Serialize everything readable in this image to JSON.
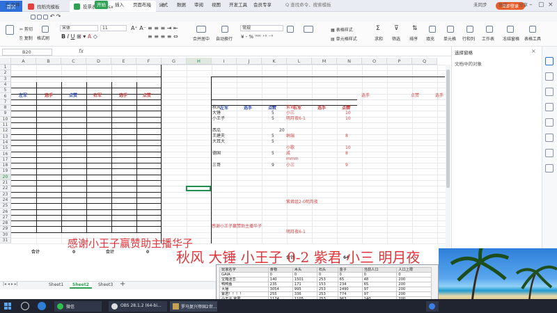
{
  "titlebar": {
    "tabs": [
      {
        "label": "首页",
        "icon": "home-icon"
      },
      {
        "label": "找稻壳模板",
        "icon": "docer-icon"
      },
      {
        "label": "投票表(1).xlsx",
        "icon": "sheet-icon"
      }
    ],
    "login_label": "立即登录"
  },
  "menu": {
    "file": "三 文件",
    "items": [
      "开始",
      "插入",
      "页面布局",
      "公式",
      "数据",
      "审阅",
      "视图",
      "开发工具",
      "会员专享"
    ],
    "search": "Q 查找命令、搜索模板",
    "sync": "未同步",
    "collab": "协作",
    "share": "分享"
  },
  "ribbon": {
    "cut": "剪切",
    "copy": "复制",
    "format_painter": "格式刷",
    "font": "宋体",
    "font_size": "11",
    "number_format": "常规",
    "merge": "合并居中",
    "wrap": "自动换行",
    "table_style": "表格样式",
    "cell_style": "单元格样式",
    "sum": "求和",
    "filter": "筛选",
    "sort": "排序",
    "fill": "填充",
    "cells": "单元格",
    "rowcol": "行和列",
    "sheet": "工作表",
    "freeze": "冻结窗格",
    "table_tools": "表格工具",
    "find": "查找",
    "symbol": "符号"
  },
  "formula": {
    "cell_ref": "B20",
    "fx": "fx"
  },
  "columns": [
    "A",
    "B",
    "C",
    "D",
    "E",
    "F",
    "G",
    "H",
    "I",
    "J",
    "K",
    "L",
    "M",
    "N",
    "O",
    "P",
    "Q"
  ],
  "rows": [
    "1",
    "2",
    "3",
    "4",
    "5",
    "6",
    "7",
    "8",
    "9",
    "10",
    "11",
    "12",
    "13",
    "14",
    "15",
    "16",
    "17",
    "18",
    "19",
    "20",
    "21",
    "22",
    "23",
    "24",
    "25",
    "26",
    "27",
    "28",
    "29",
    "30",
    "31"
  ],
  "left_table": {
    "headers": [
      "左军",
      "选手",
      "点赞",
      "右军",
      "选手",
      "点赞"
    ],
    "total_label_1": "合计",
    "total_value_1": "0",
    "total_label_2": "合计",
    "total_value_2": "0"
  },
  "right_table": {
    "headers": [
      "左军",
      "选手",
      "点赞",
      "右军",
      "选手",
      "点赞"
    ],
    "left_names": [
      "秋风",
      "大锤",
      "小王子",
      "西瓜",
      "王建夫",
      "大耳大",
      "德国",
      "三哥"
    ],
    "left_values": [
      "5",
      "5",
      "5",
      "20",
      "5",
      "5",
      "5",
      "9"
    ],
    "right_names": [
      "紫君",
      "小三",
      "明月夜6-1",
      "纳瑞",
      "小歌",
      "成",
      "mmm",
      "小三"
    ],
    "right_values": [
      "10",
      "10",
      "10",
      "8",
      "10",
      "8",
      "9"
    ],
    "note1": "紫君组2-0明月夜",
    "note2": "感谢小王子赢赞助主播华子",
    "note3": "明月夜6-1",
    "total_label": "合计",
    "total_value": "64"
  },
  "far_right_headers": [
    "选手",
    "点赞",
    "选手"
  ],
  "captions": {
    "line1": "感谢小王子赢赞助主播华子",
    "line2": "秋风 大锤 小王子 0-2 紫君 小三 明月夜"
  },
  "side_panel": {
    "title": "选择窗格",
    "subtitle": "文档中的对象"
  },
  "sheets": [
    "Sheet1",
    "Sheet2",
    "Sheet3"
  ],
  "active_sheet": "Sheet2",
  "popup_table": {
    "headers": [
      "玩家名字",
      "食物",
      "木头",
      "石头",
      "金子",
      "当前人口",
      "人口上限"
    ],
    "rows": [
      [
        "GAIA",
        "0",
        "0",
        "0",
        "0",
        "0",
        "0"
      ],
      [
        "宝箱迷恋",
        "140",
        "1501",
        "253",
        "65",
        "48",
        "200"
      ],
      [
        "鸭鸭鱼",
        "235",
        "171",
        "153",
        "234",
        "65",
        "200"
      ],
      [
        "大锤",
        "3054",
        "995",
        "253",
        "2490",
        "97",
        "200"
      ],
      [
        "紫君！！！！",
        "255",
        "336",
        "253",
        "774",
        "97",
        "200"
      ],
      [
        "小王子 紫君",
        "1174",
        "1105",
        "253",
        "963",
        "140",
        "200"
      ],
      [
        "小三",
        "545",
        "1534",
        "253",
        "1234",
        "105",
        "200"
      ]
    ]
  },
  "taskbar": {
    "wechat": "微信",
    "obs": "OBS 28.1.2 (64-bi...",
    "game": "罗马复兴帝国2世...",
    "dingtalk": "钉钉"
  },
  "colors": {
    "accent_green": "#2fa254",
    "brand_blue": "#2e6fd9",
    "caption_red": "#e0363b"
  }
}
